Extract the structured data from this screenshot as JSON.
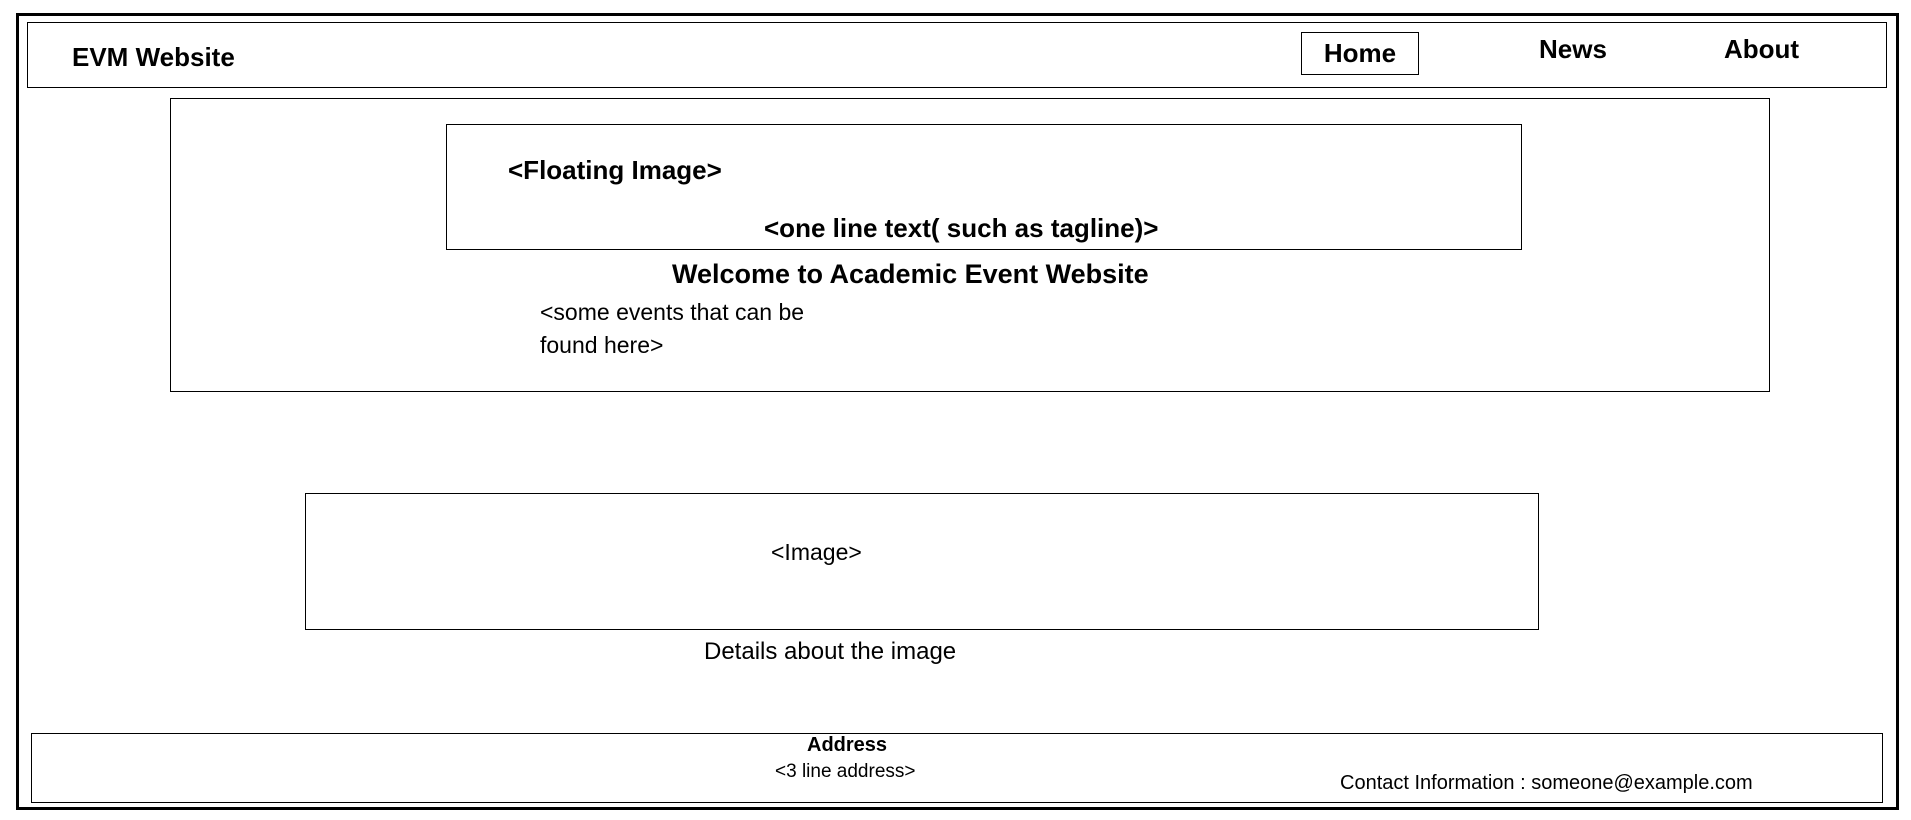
{
  "header": {
    "brand": "EVM Website",
    "nav": [
      "Home",
      "News",
      "About"
    ]
  },
  "hero": {
    "floating_image": "<Floating Image>",
    "tagline": "<one line text( such as tagline)>",
    "welcome": "Welcome to Academic Event Website",
    "events_line1": "<some events that can be",
    "events_line2": "found here>"
  },
  "image_section": {
    "placeholder": "<Image>",
    "caption": "Details about the image"
  },
  "footer": {
    "address_heading": "Address",
    "address_text": "<3 line address>",
    "contact": "Contact Information : someone@example.com"
  }
}
